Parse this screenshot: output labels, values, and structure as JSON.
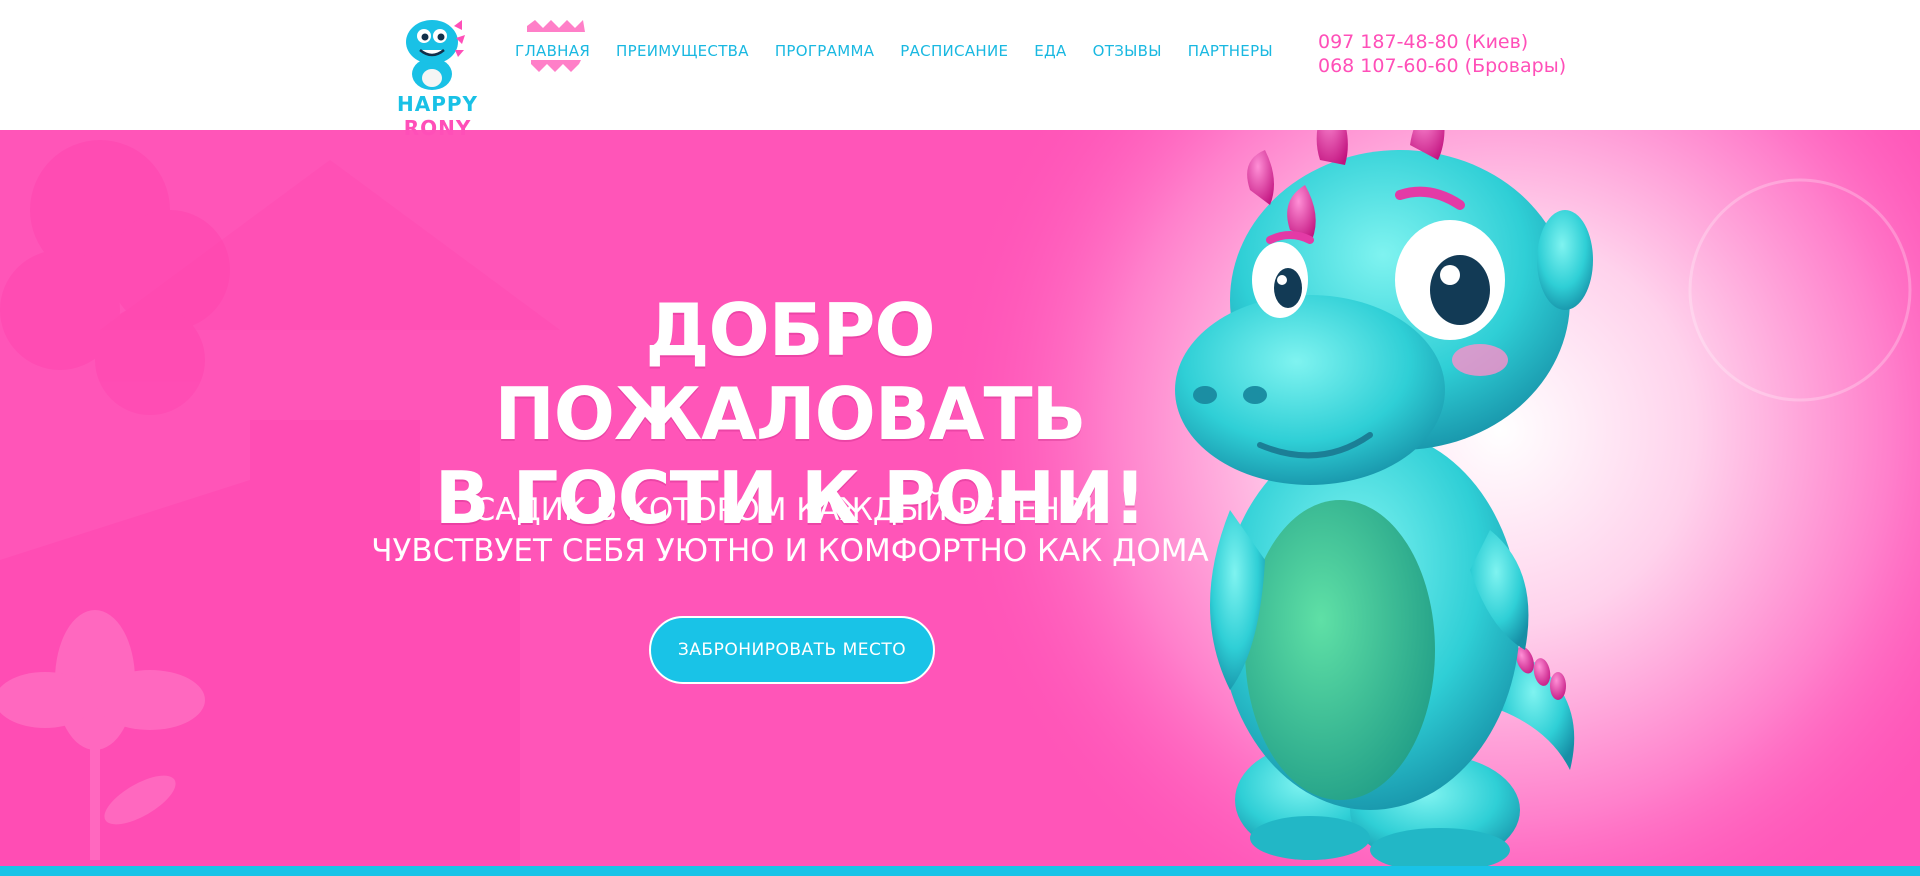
{
  "header": {
    "logo": {
      "word1": "HAPPY",
      "word2": "RONY"
    },
    "nav": [
      {
        "label": "ГЛАВНАЯ",
        "active": true
      },
      {
        "label": "ПРЕИМУЩЕСТВА"
      },
      {
        "label": "ПРОГРАММА"
      },
      {
        "label": "РАСПИСАНИЕ"
      },
      {
        "label": "ЕДА"
      },
      {
        "label": "ОТЗЫВЫ"
      },
      {
        "label": "ПАРТНЕРЫ"
      }
    ],
    "phones": [
      "097 187-48-80 (Киев)",
      "068 107-60-60 (Бровары)"
    ]
  },
  "hero": {
    "title_line1": "ДОБРО ПОЖАЛОВАТЬ",
    "title_line2": "В ГОСТИ К РОНИ!",
    "subtitle_line1": "САДИК В КОТОРОМ КАЖДЫЙ РЕБЁНОК",
    "subtitle_line2": "ЧУВСТВУЕТ СЕБЯ УЮТНО И КОМФОРТНО КАК ДОМА",
    "cta_label": "ЗАБРОНИРОВАТЬ МЕСТО"
  },
  "colors": {
    "pink": "#ff4fb8",
    "cyan": "#19c3e7",
    "white": "#ffffff"
  },
  "icons": {
    "mascot": "dinosaur-mascot-icon",
    "nav_active_marker": "zigzag-marker-icon"
  }
}
